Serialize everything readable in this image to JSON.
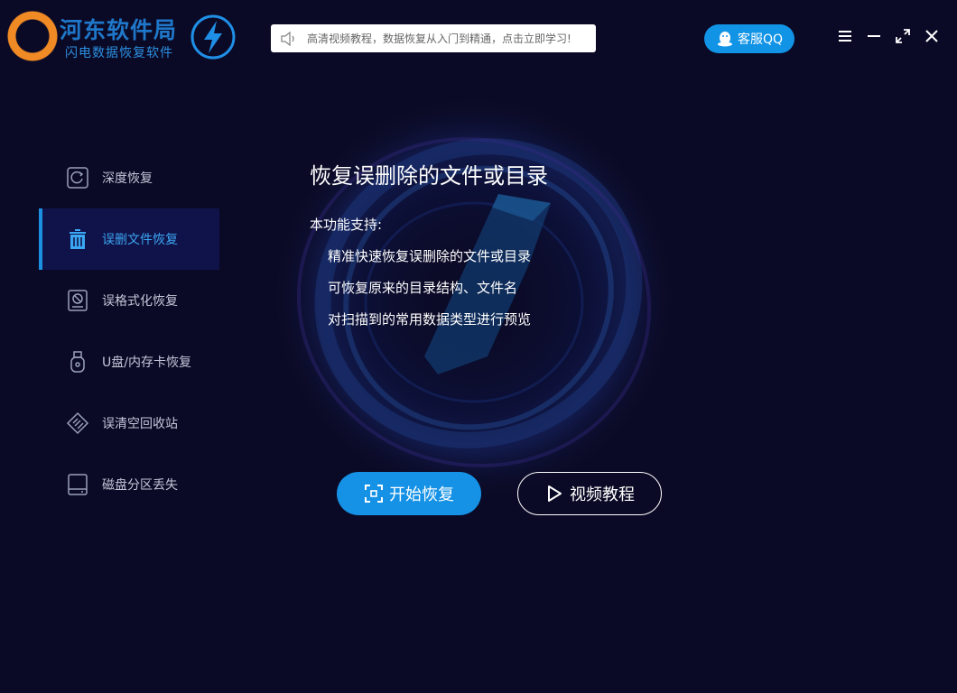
{
  "header": {
    "logo_title": "河东软件局",
    "logo_sub": "闪电数据恢复软件",
    "notice_text": "高清视频教程，数据恢复从入门到精通，点击立即学习!",
    "qq_label": "客服QQ",
    "colors": {
      "accent": "#1193e6",
      "logo_orange": "#f08a24"
    }
  },
  "sidebar": {
    "items": [
      {
        "label": "深度恢复",
        "icon": "deep-recovery-icon",
        "active": false
      },
      {
        "label": "误删文件恢复",
        "icon": "trash-icon",
        "active": true
      },
      {
        "label": "误格式化恢复",
        "icon": "format-disk-icon",
        "active": false
      },
      {
        "label": "U盘/内存卡恢复",
        "icon": "usb-icon",
        "active": false
      },
      {
        "label": "误清空回收站",
        "icon": "recycle-bin-icon",
        "active": false
      },
      {
        "label": "磁盘分区丢失",
        "icon": "disk-partition-icon",
        "active": false
      }
    ]
  },
  "main": {
    "title": "恢复误删除的文件或目录",
    "support_heading": "本功能支持:",
    "features": [
      "精准快速恢复误删除的文件或目录",
      "可恢复原来的目录结构、文件名",
      "对扫描到的常用数据类型进行预览"
    ],
    "start_label": "开始恢复",
    "video_label": "视频教程"
  }
}
